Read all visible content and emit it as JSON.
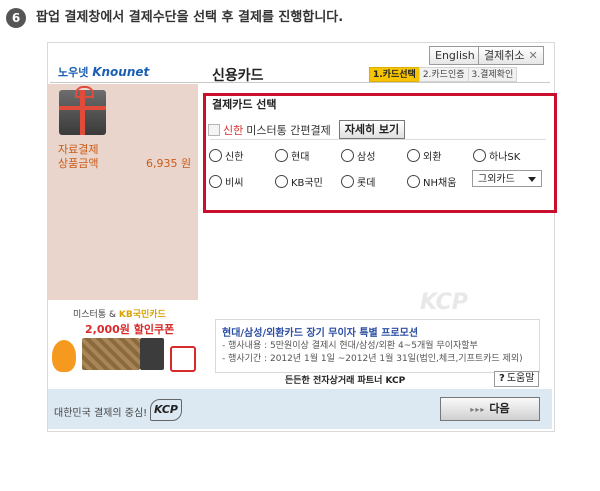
{
  "step": {
    "number": "6",
    "text": "팝업 결제창에서 결제수단을 선택 후 결제를 진행합니다."
  },
  "topbar": {
    "english_label": "English",
    "cancel_label": "결제취소"
  },
  "header": {
    "logo_ko": "노우넷",
    "logo_en": "Knounet",
    "title": "신용카드",
    "steps": [
      {
        "label": "1.카드선택",
        "active": true
      },
      {
        "label": "2.카드인증",
        "active": false
      },
      {
        "label": "3.결제확인",
        "active": false
      }
    ]
  },
  "product": {
    "name": "자료결제",
    "amount_label": "상품금액",
    "amount_value": "6,935 원"
  },
  "coupon": {
    "title": "미스터통 &",
    "kb": "KB국민카드",
    "amount": "2,000원 할인쿠폰"
  },
  "card_select": {
    "title": "결제카드 선택",
    "easy_pay_card": "신한",
    "easy_pay_text": "미스터통 간편결제",
    "detail_button": "자세히 보기",
    "cards": [
      "신한",
      "현대",
      "삼성",
      "외환",
      "하나SK",
      "비씨",
      "KB국민",
      "롯데",
      "NH채움"
    ],
    "other_select": "그외카드"
  },
  "promo": {
    "title": "현대/삼성/외환카드 장기 무이자 특별 프로모션",
    "line1": "- 행사내용 : 5만원이상 결제시 현대/삼성/외환 4~5개월 무이자할부",
    "line2": "- 행사기간 : 2012년 1월 1일 ~2012년 1월 31일(법인,체크,기프트카드 제외)"
  },
  "partner": {
    "text": "든든한 전자상거래 파트너 KCP"
  },
  "help": {
    "label": "도움말"
  },
  "footer": {
    "text": "대한민국 결제의 중심!",
    "kcp": "KCP",
    "next_label": "다음"
  },
  "watermark": {
    "text": "KCP"
  }
}
